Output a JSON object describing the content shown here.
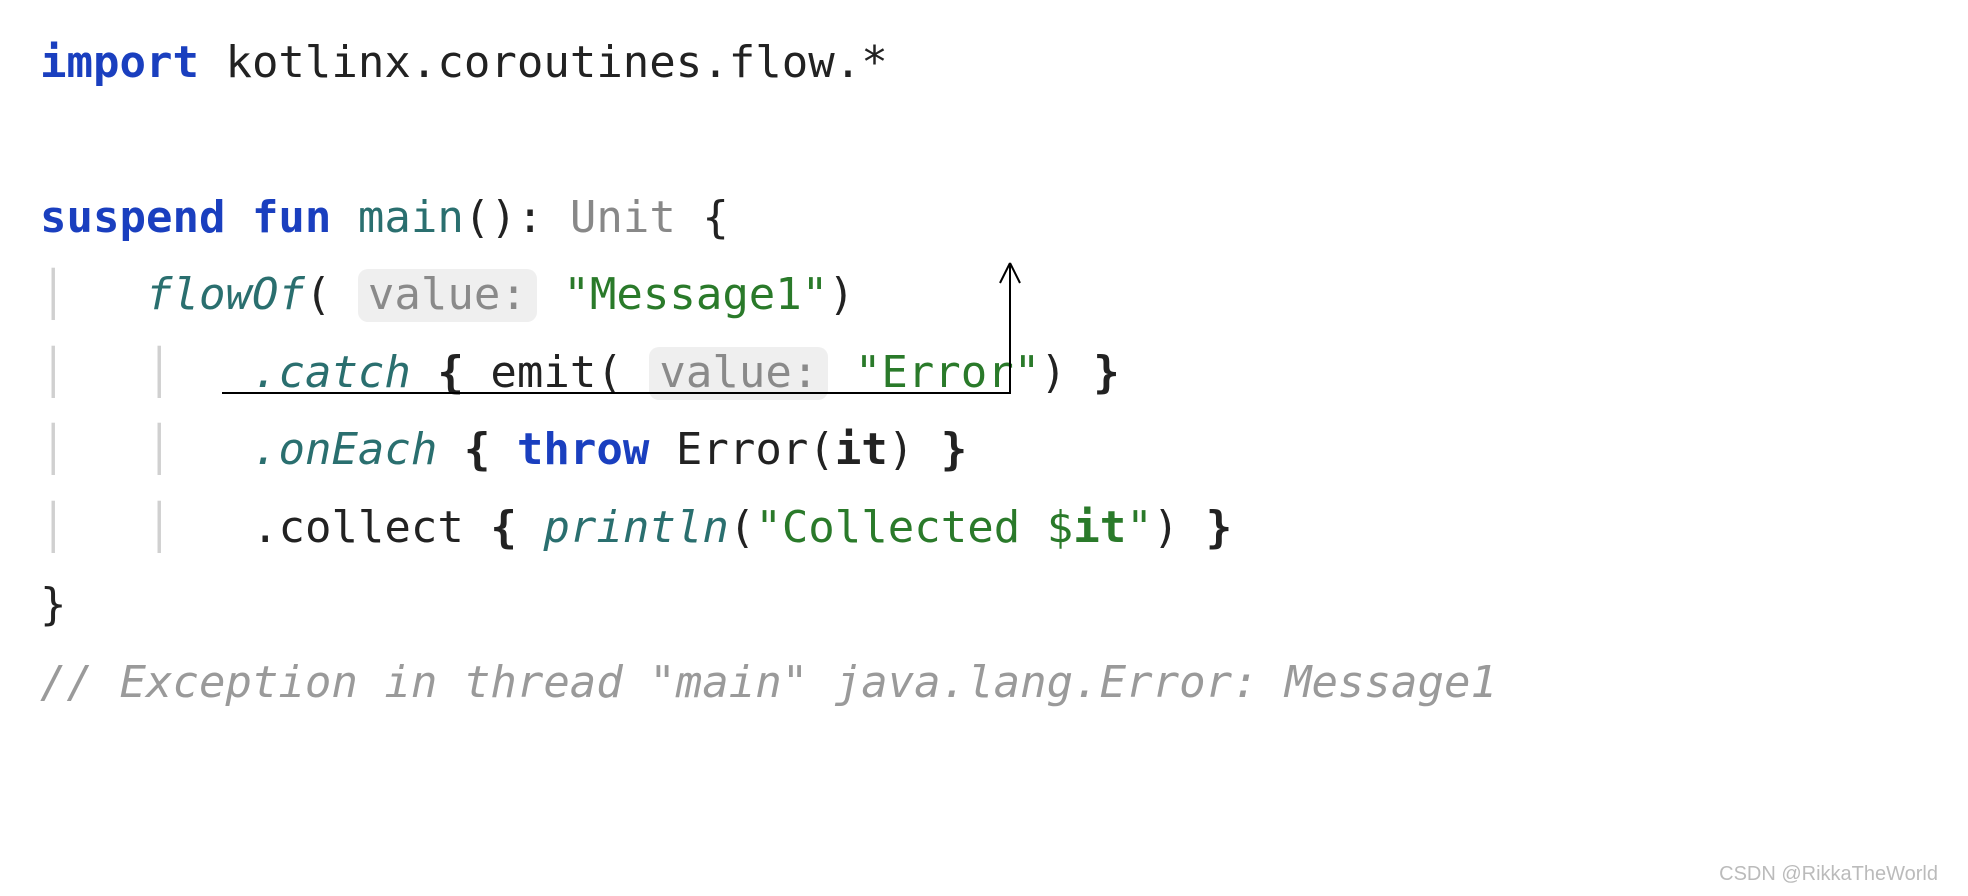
{
  "code": {
    "import_kw": "import",
    "import_target": "kotlinx.coroutines.flow.*",
    "suspend_kw": "suspend",
    "fun_kw": "fun",
    "main_name": "main",
    "return_type": "Unit",
    "flowOf_call": "flowOf",
    "hint_value1": "value:",
    "str_msg1": "\"Message1\"",
    "catch_call": ".catch",
    "emit_call": "emit",
    "hint_value2": "value:",
    "str_error": "\"Error\"",
    "onEach_call": ".onEach",
    "throw_kw": "throw",
    "Error_ctor": "Error",
    "it_kw": "it",
    "collect_call": ".collect",
    "println_call": "println",
    "str_collected_prefix": "\"Collected ",
    "dollar": "$",
    "str_collected_suffix": "\"",
    "comment_line": "// Exception in thread \"main\" java.lang.Error: Message1"
  },
  "watermark": "CSDN @RikkaTheWorld"
}
